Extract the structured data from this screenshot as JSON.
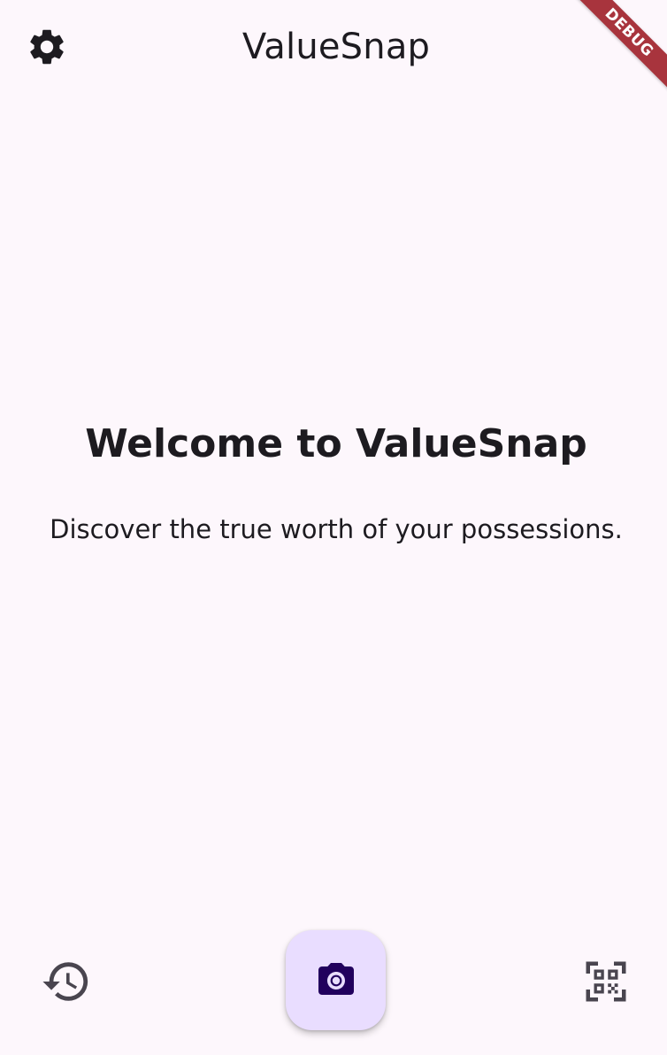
{
  "appbar": {
    "title": "ValueSnap",
    "settings_icon": "gear-icon"
  },
  "debug_banner": {
    "label": "DEBUG",
    "color": "#a8343d"
  },
  "main": {
    "headline": "Welcome to ValueSnap",
    "subtitle": "Discover the true worth of your possessions."
  },
  "bottom_bar": {
    "history_icon": "history-icon",
    "camera_icon": "camera-icon",
    "scan_icon": "qr-code-scanner-icon"
  },
  "colors": {
    "background": "#fdf7fc",
    "text": "#1d1b20",
    "fab_background": "#e9ddff",
    "fab_icon": "#21005d",
    "icon": "#1d1b20",
    "muted_icon": "#49454f"
  }
}
